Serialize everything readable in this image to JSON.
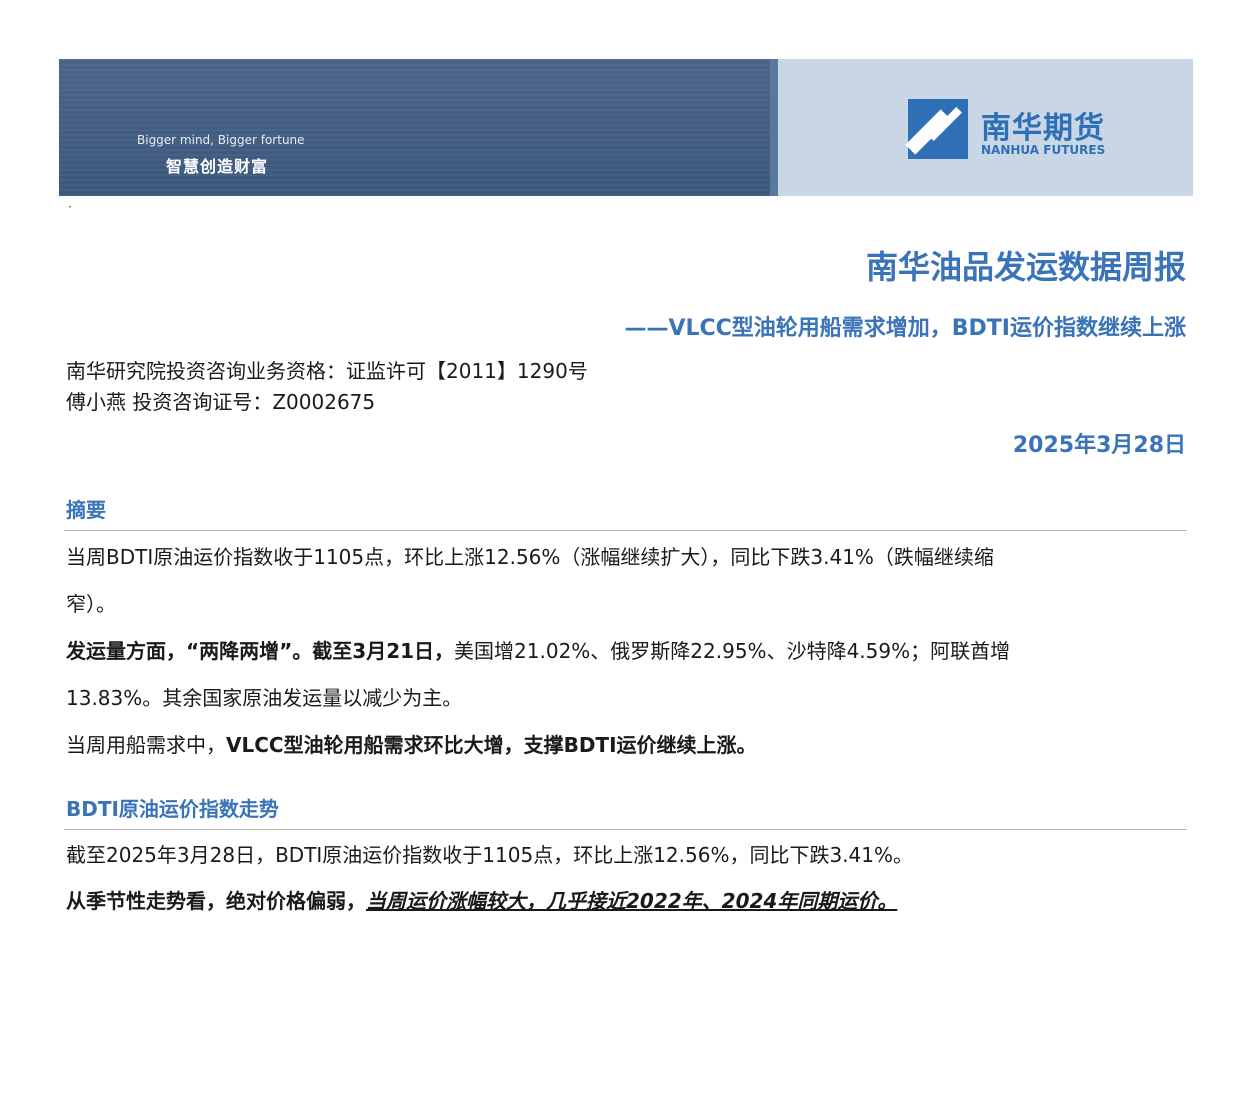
{
  "banner": {
    "slogan_en": "Bigger mind, Bigger fortune",
    "slogan_cn": "智慧创造财富",
    "logo_cn": "南华期货",
    "logo_en": "NANHUA FUTURES",
    "colors": {
      "dark": "#3f5a7e",
      "light": "#c9d6e6",
      "brand": "#2f6fb6"
    }
  },
  "marker": "·",
  "report": {
    "title": "南华油品发运数据周报",
    "subtitle": "——VLCC型油轮用船需求增加，BDTI运价指数继续上涨",
    "license": "南华研究院投资咨询业务资格：证监许可【2011】1290号",
    "analyst": "傅小燕 投资咨询证号：Z0002675",
    "date": "2025年3月28日"
  },
  "summary": {
    "heading": "摘要",
    "p1_line1": "当周BDTI原油运价指数收于1105点，环比上涨12.56%（涨幅继续扩大），同比下跌3.41%（跌幅继续缩",
    "p1_line2": "窄）。",
    "p2_bold": "发运量方面，“两降两增”。截至3月21日，",
    "p2_rest": "美国增21.02%、俄罗斯降22.95%、沙特降4.59%；阿联酋增",
    "p2_line2": "13.83%。其余国家原油发运量以减少为主。",
    "p3_normal": "当周用船需求中，",
    "p3_bold": "VLCC型油轮用船需求环比大增，支撑BDTI运价继续上涨。"
  },
  "bdti": {
    "heading": "BDTI原油运价指数走势",
    "p1": "截至2025年3月28日，BDTI原油运价指数收于1105点，环比上涨12.56%，同比下跌3.41%。",
    "p2_bold": "从季节性走势看，绝对价格偏弱，",
    "p2_underline": "当周运价涨幅较大，几乎接近2022年、2024年同期运价。"
  }
}
